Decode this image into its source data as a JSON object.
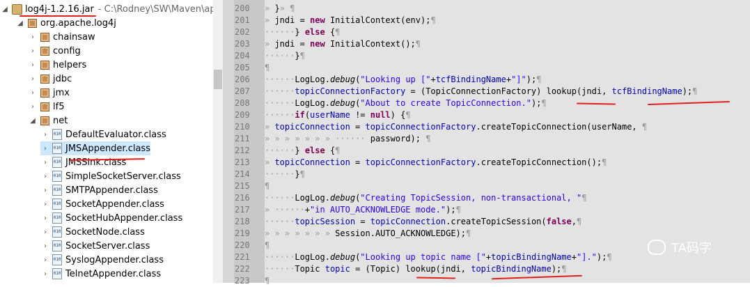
{
  "tree": {
    "jar": {
      "name": "log4j-1.2.16.jar",
      "path": "- C:\\Rodney\\SW\\Maven\\apach"
    },
    "root_package": "org.apache.log4j",
    "packages": [
      "chainsaw",
      "config",
      "helpers",
      "jdbc",
      "jmx",
      "lf5",
      "net"
    ],
    "net_classes": [
      "DefaultEvaluator.class",
      "JMSAppender.class",
      "JMSSink.class",
      "SimpleSocketServer.class",
      "SMTPAppender.class",
      "SocketAppender.class",
      "SocketHubAppender.class",
      "SocketNode.class",
      "SocketServer.class",
      "SyslogAppender.class",
      "TelnetAppender.class"
    ]
  },
  "editor": {
    "line_numbers": [
      "200",
      "201",
      "202",
      "203",
      "204",
      "205",
      "206",
      "207",
      "208",
      "209",
      "210",
      "211",
      "212",
      "213",
      "214",
      "215",
      "216",
      "217",
      "218",
      "219",
      "220",
      "221",
      "222",
      "223"
    ],
    "lines": [
      [
        [
          "ws",
          "» "
        ],
        [
          "",
          "}"
        ],
        [
          "ws",
          "» ¶"
        ]
      ],
      [
        [
          "ws",
          "» "
        ],
        [
          "",
          "jndi = "
        ],
        [
          "kw",
          "new"
        ],
        [
          "",
          " InitialContext(env);"
        ],
        [
          "ws",
          "¶"
        ]
      ],
      [
        [
          "ws",
          "······"
        ],
        [
          "",
          "} "
        ],
        [
          "kw",
          "else"
        ],
        [
          "",
          " {"
        ],
        [
          "ws",
          "¶"
        ]
      ],
      [
        [
          "ws",
          "» "
        ],
        [
          "",
          "jndi = "
        ],
        [
          "kw",
          "new"
        ],
        [
          "",
          " InitialContext();"
        ],
        [
          "ws",
          "¶"
        ]
      ],
      [
        [
          "ws",
          "······"
        ],
        [
          "",
          "}"
        ],
        [
          "ws",
          "¶"
        ]
      ],
      [
        [
          "ws",
          "¶"
        ]
      ],
      [
        [
          "ws",
          "······"
        ],
        [
          "",
          "LogLog."
        ],
        [
          "it",
          "debug"
        ],
        [
          "",
          "("
        ],
        [
          "str",
          "\"Looking up [\""
        ],
        [
          "",
          "+"
        ],
        [
          "fld",
          "tcfBindingName"
        ],
        [
          "",
          "+"
        ],
        [
          "str",
          "\"]\""
        ],
        [
          "",
          ");"
        ],
        [
          "ws",
          "¶"
        ]
      ],
      [
        [
          "ws",
          "······"
        ],
        [
          "fld",
          "topicConnectionFactory"
        ],
        [
          "",
          " = (TopicConnectionFactory) lookup(jndi, "
        ],
        [
          "fld",
          "tcfBindingName"
        ],
        [
          "",
          ");"
        ],
        [
          "ws",
          "¶"
        ]
      ],
      [
        [
          "ws",
          "······"
        ],
        [
          "",
          "LogLog."
        ],
        [
          "it",
          "debug"
        ],
        [
          "",
          "("
        ],
        [
          "str",
          "\"About to create TopicConnection.\""
        ],
        [
          "",
          ");"
        ],
        [
          "ws",
          "¶"
        ]
      ],
      [
        [
          "ws",
          "······"
        ],
        [
          "kw",
          "if"
        ],
        [
          "",
          "("
        ],
        [
          "fld",
          "userName"
        ],
        [
          "",
          " != "
        ],
        [
          "kw",
          "null"
        ],
        [
          "",
          ") {"
        ],
        [
          "ws",
          "¶"
        ]
      ],
      [
        [
          "ws",
          "» "
        ],
        [
          "fld",
          "topicConnection"
        ],
        [
          "",
          " = "
        ],
        [
          "fld",
          "topicConnectionFactory"
        ],
        [
          "",
          ".createTopicConnection(userName, "
        ],
        [
          "ws",
          "¶"
        ]
      ],
      [
        [
          "ws",
          "» » » » » » » ······"
        ],
        [
          "",
          " password);"
        ],
        [
          "ws",
          " ¶"
        ]
      ],
      [
        [
          "ws",
          "······"
        ],
        [
          "",
          "} "
        ],
        [
          "kw",
          "else"
        ],
        [
          "",
          " {"
        ],
        [
          "ws",
          "¶"
        ]
      ],
      [
        [
          "ws",
          "» "
        ],
        [
          "fld",
          "topicConnection"
        ],
        [
          "",
          " = "
        ],
        [
          "fld",
          "topicConnectionFactory"
        ],
        [
          "",
          ".createTopicConnection();"
        ],
        [
          "ws",
          "¶"
        ]
      ],
      [
        [
          "ws",
          "······"
        ],
        [
          "",
          "}"
        ],
        [
          "ws",
          "¶"
        ]
      ],
      [
        [
          "ws",
          "¶"
        ]
      ],
      [
        [
          "ws",
          "······"
        ],
        [
          "",
          "LogLog."
        ],
        [
          "it",
          "debug"
        ],
        [
          "",
          "("
        ],
        [
          "str",
          "\"Creating TopicSession, non-transactional, \""
        ],
        [
          "ws",
          "¶"
        ]
      ],
      [
        [
          "ws",
          "» ······"
        ],
        [
          "",
          "+"
        ],
        [
          "str",
          "\"in AUTO_ACKNOWLEDGE mode.\""
        ],
        [
          "",
          ");"
        ],
        [
          "ws",
          "¶"
        ]
      ],
      [
        [
          "ws",
          "······"
        ],
        [
          "fld",
          "topicSession"
        ],
        [
          "",
          " = "
        ],
        [
          "fld",
          "topicConnection"
        ],
        [
          "",
          ".createTopicSession("
        ],
        [
          "kw",
          "false"
        ],
        [
          "",
          ","
        ],
        [
          "ws",
          "¶"
        ]
      ],
      [
        [
          "ws",
          "» » » » » » » "
        ],
        [
          "",
          "Session.AUTO_ACKNOWLEDGE);"
        ],
        [
          "ws",
          "¶"
        ]
      ],
      [
        [
          "ws",
          "¶"
        ]
      ],
      [
        [
          "ws",
          "······"
        ],
        [
          "",
          "LogLog."
        ],
        [
          "it",
          "debug"
        ],
        [
          "",
          "("
        ],
        [
          "str",
          "\"Looking up topic name [\""
        ],
        [
          "",
          "+"
        ],
        [
          "fld",
          "topicBindingName"
        ],
        [
          "",
          "+"
        ],
        [
          "str",
          "\"].\""
        ],
        [
          "",
          ");"
        ],
        [
          "ws",
          "¶"
        ]
      ],
      [
        [
          "ws",
          "······"
        ],
        [
          "",
          "Topic "
        ],
        [
          "fld",
          "topic"
        ],
        [
          "",
          " = (Topic) lookup(jndi, "
        ],
        [
          "fld",
          "topicBindingName"
        ],
        [
          "",
          ");"
        ],
        [
          "ws",
          "¶"
        ]
      ],
      [
        [
          "ws",
          "¶"
        ]
      ]
    ]
  },
  "watermark": "TA码字"
}
